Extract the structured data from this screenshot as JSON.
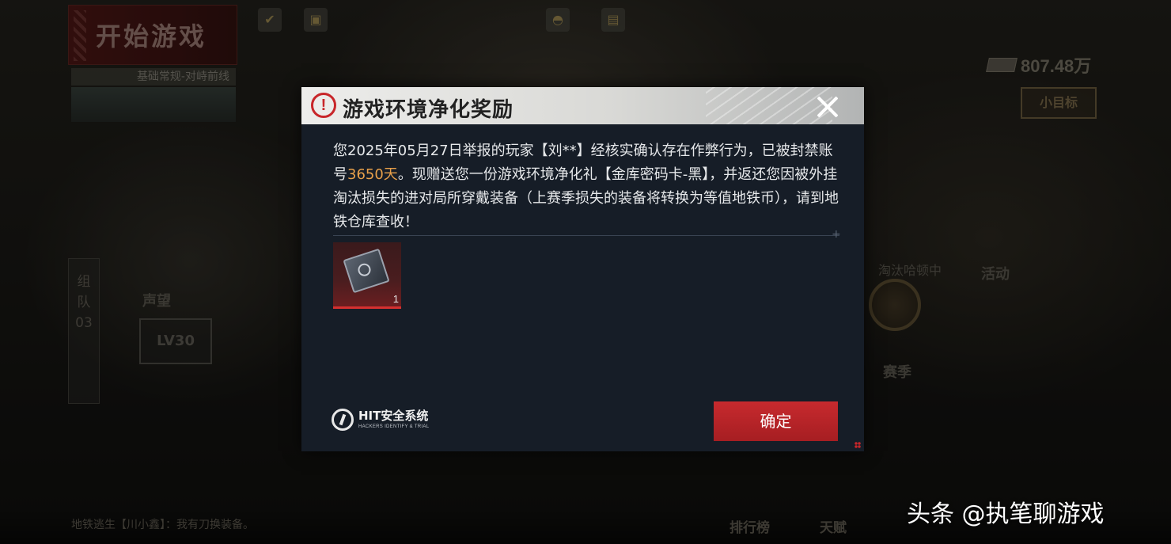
{
  "lobby": {
    "start_game_label": "开始游戏",
    "mode_label": "基础常规-对峙前线",
    "currency_amount": "807.48万",
    "goal_button_label": "小目标",
    "team_panel_label": [
      "组",
      "队",
      "03"
    ],
    "level_badge": "LV30",
    "reputation_label": "声望",
    "season_middle_text": "淘汰哈顿中",
    "activity_label": "活动",
    "season_label": "赛季",
    "chat_message": "地铁逃生【川小鑫】：我有刀换装备。",
    "leaderboard_label": "排行榜",
    "daily_label": "天赋"
  },
  "watermark": "头条 @执笔聊游戏",
  "dialog": {
    "title": "游戏环境净化奖励",
    "body_part1": "您2025年05月27日举报的玩家【刘**】经核实确认存在作弊行为，已被封禁账号",
    "ban_duration": "3650天",
    "body_part2": "。现赠送您一份游戏环境净化礼【金库密码卡-黑】，并返还您因被外挂淘汰损失的进对局所穿戴装备（上赛季损失的装备将转换为等值地铁币），请到地铁仓库查收！",
    "reward_item": {
      "icon": "vault-password-card-icon",
      "count": "1"
    },
    "security_logo_name": "HIT安全系统",
    "security_logo_subtitle": "HACKERS IDENTIFY & TRIAL",
    "confirm_label": "确定"
  },
  "colors": {
    "accent_red": "#c72a2e",
    "highlight_orange": "#e8a04a",
    "dialog_bg": "#161d27"
  }
}
